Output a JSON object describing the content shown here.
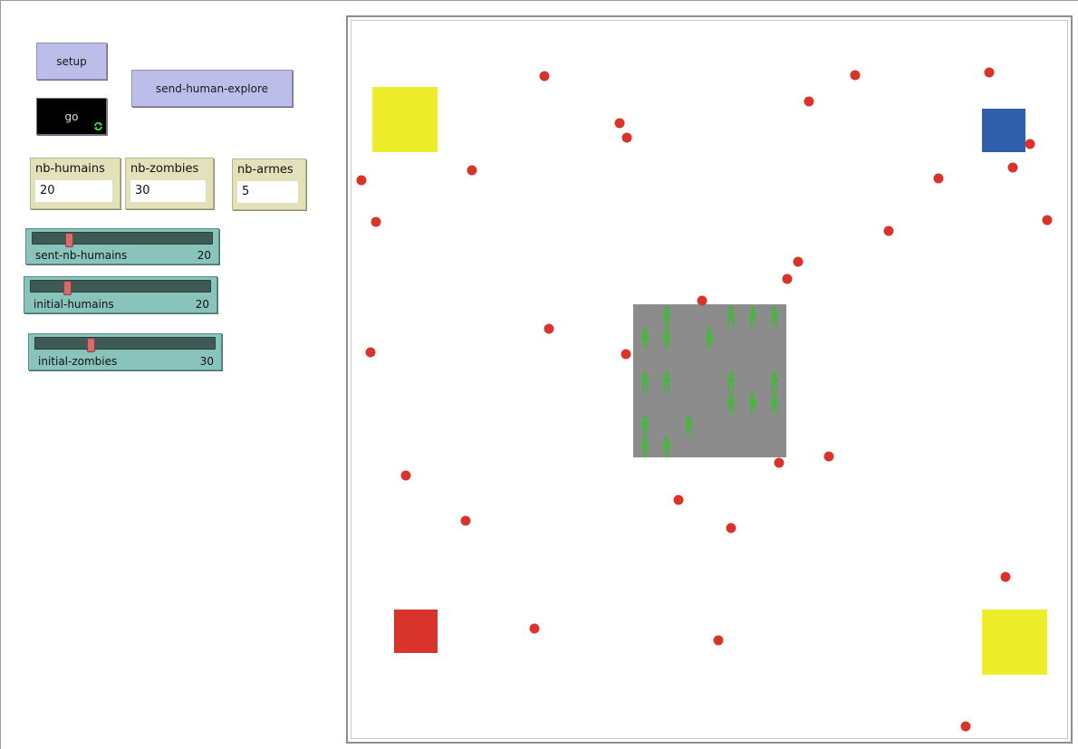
{
  "controls": {
    "setup_label": "setup",
    "send_label": "send-human-explore",
    "go_label": "go"
  },
  "monitors": [
    {
      "label": "nb-humains",
      "value": "20"
    },
    {
      "label": "nb-zombies",
      "value": "30"
    },
    {
      "label": "nb-armes",
      "value": "5"
    }
  ],
  "sliders": [
    {
      "label": "sent-nb-humains",
      "value": "20",
      "fraction": 0.19
    },
    {
      "label": "initial-humains",
      "value": "20",
      "fraction": 0.19
    },
    {
      "label": "initial-zombies",
      "value": "30",
      "fraction": 0.3
    }
  ],
  "colors": {
    "zombie": "#d9342b",
    "human": "#4fb045",
    "safe_zone": "#8c8c8c",
    "yellow_patch": "#eded2b",
    "blue_patch": "#2f5eaa",
    "red_patch": "#d9342b"
  }
}
